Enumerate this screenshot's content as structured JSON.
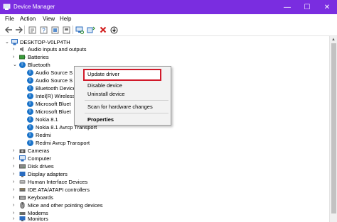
{
  "window": {
    "title": "Device Manager",
    "minimize_glyph": "—",
    "maximize_glyph": "☐",
    "close_glyph": "✕",
    "titlebar_color": "#7a2de0"
  },
  "menubar": {
    "file": "File",
    "action": "Action",
    "view": "View",
    "help": "Help"
  },
  "toolbar": {
    "icons": [
      "back-icon",
      "forward-icon",
      "properties-icon",
      "help-icon",
      "show-hidden-icon",
      "refresh-icon",
      "scan-hardware-icon",
      "uninstall-icon",
      "update-driver-icon"
    ]
  },
  "tree": {
    "root": "DESKTOP-V0LP4TH",
    "items": [
      {
        "label": "Audio inputs and outputs",
        "icon": "speaker-icon"
      },
      {
        "label": "Batteries",
        "icon": "battery-icon"
      },
      {
        "label": "Bluetooth",
        "icon": "bluetooth-icon",
        "expanded": true
      }
    ],
    "bluetooth_children": [
      "Audio Source S",
      "Audio Source S",
      "Bluetooth Device",
      "Intel(R) Wireless",
      "Microsoft Bluet",
      "Microsoft Bluet",
      "Nokia 8.1",
      "Nokia 8.1 Avrcp Transport",
      "Redmi",
      "Redmi Avrcp Transport"
    ],
    "after_items": [
      {
        "label": "Cameras",
        "icon": "camera-icon"
      },
      {
        "label": "Computer",
        "icon": "computer-icon"
      },
      {
        "label": "Disk drives",
        "icon": "disk-icon"
      },
      {
        "label": "Display adapters",
        "icon": "display-icon"
      },
      {
        "label": "Human Interface Devices",
        "icon": "hid-icon"
      },
      {
        "label": "IDE ATA/ATAPI controllers",
        "icon": "ide-icon"
      },
      {
        "label": "Keyboards",
        "icon": "keyboard-icon"
      },
      {
        "label": "Mice and other pointing devices",
        "icon": "mouse-icon"
      },
      {
        "label": "Modems",
        "icon": "modem-icon"
      },
      {
        "label": "Monitors",
        "icon": "monitor-icon"
      }
    ]
  },
  "context_menu": {
    "update_driver": "Update driver",
    "disable_device": "Disable device",
    "uninstall_device": "Uninstall device",
    "scan_hardware": "Scan for hardware changes",
    "properties": "Properties",
    "highlight_color": "#d11a2a"
  }
}
